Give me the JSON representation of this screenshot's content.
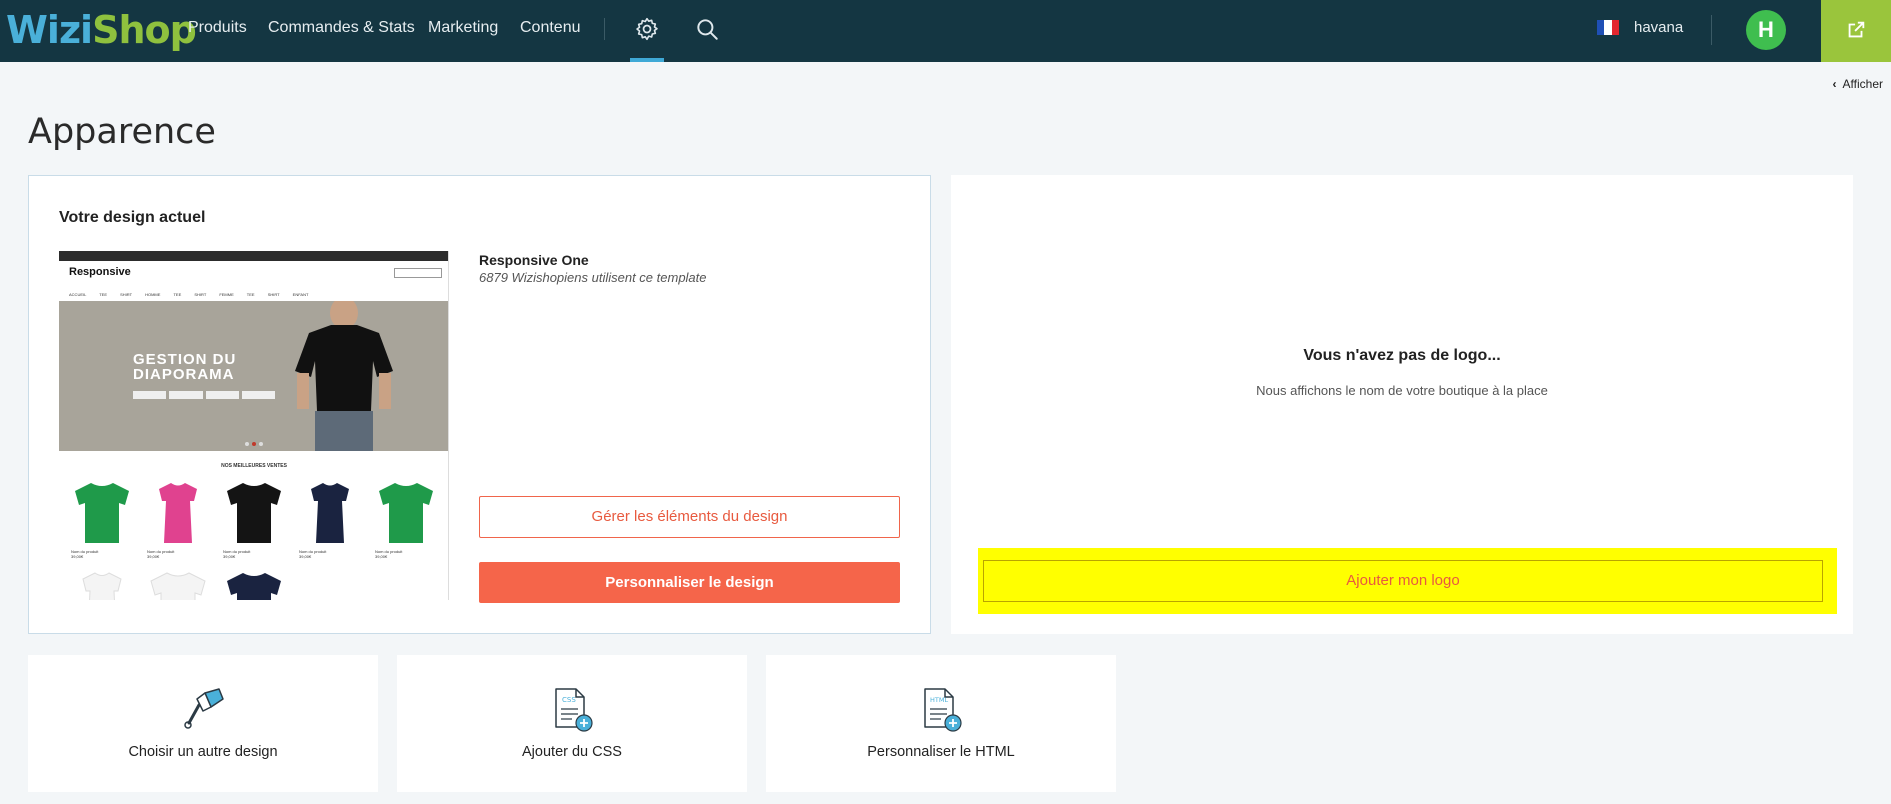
{
  "app": {
    "logo_part1": "Wizi",
    "logo_part2": "Shop"
  },
  "nav": {
    "items": [
      "Produits",
      "Commandes & Stats",
      "Marketing",
      "Contenu"
    ],
    "settings_icon": "gear-icon",
    "search_icon": "search-icon"
  },
  "account": {
    "name": "havana",
    "avatar_initial": "H",
    "flag_icon": "france-flag-icon",
    "external_icon": "external-link-icon"
  },
  "subbar": {
    "show_label": "Afficher"
  },
  "page": {
    "title": "Apparence"
  },
  "design_card": {
    "title": "Votre design actuel",
    "template_name": "Responsive One",
    "template_usage": "6879 Wizishopiens utilisent ce template",
    "manage_button": "Gérer les éléments du design",
    "customize_button": "Personnaliser le design",
    "preview": {
      "brand": "Responsive",
      "menu": "ACCUEIL   TEE SHIRT HOMME   TEE SHIRT FEMME   TEE SHIRT ENFANT",
      "hero_line1": "GESTION DU",
      "hero_line2": "DIAPORAMA",
      "section_title": "NOS MEILLEURES VENTES",
      "product_caption": "Nom du produit",
      "product_price": "39,00€"
    }
  },
  "logo_card": {
    "title": "Vous n'avez pas de logo...",
    "subtitle": "Nous affichons le nom de votre boutique à la place",
    "add_button": "Ajouter mon logo"
  },
  "tiles": [
    {
      "label": "Choisir un autre design",
      "icon": "paint-brush-icon"
    },
    {
      "label": "Ajouter du CSS",
      "icon": "css-file-add-icon",
      "badge": "CSS"
    },
    {
      "label": "Personnaliser le HTML",
      "icon": "html-file-add-icon",
      "badge": "HTML"
    }
  ],
  "colors": {
    "topbar": "#143642",
    "accent_orange": "#f5654a",
    "highlight": "#ffff00",
    "green": "#3fbe4f",
    "lime": "#9ac53c"
  }
}
